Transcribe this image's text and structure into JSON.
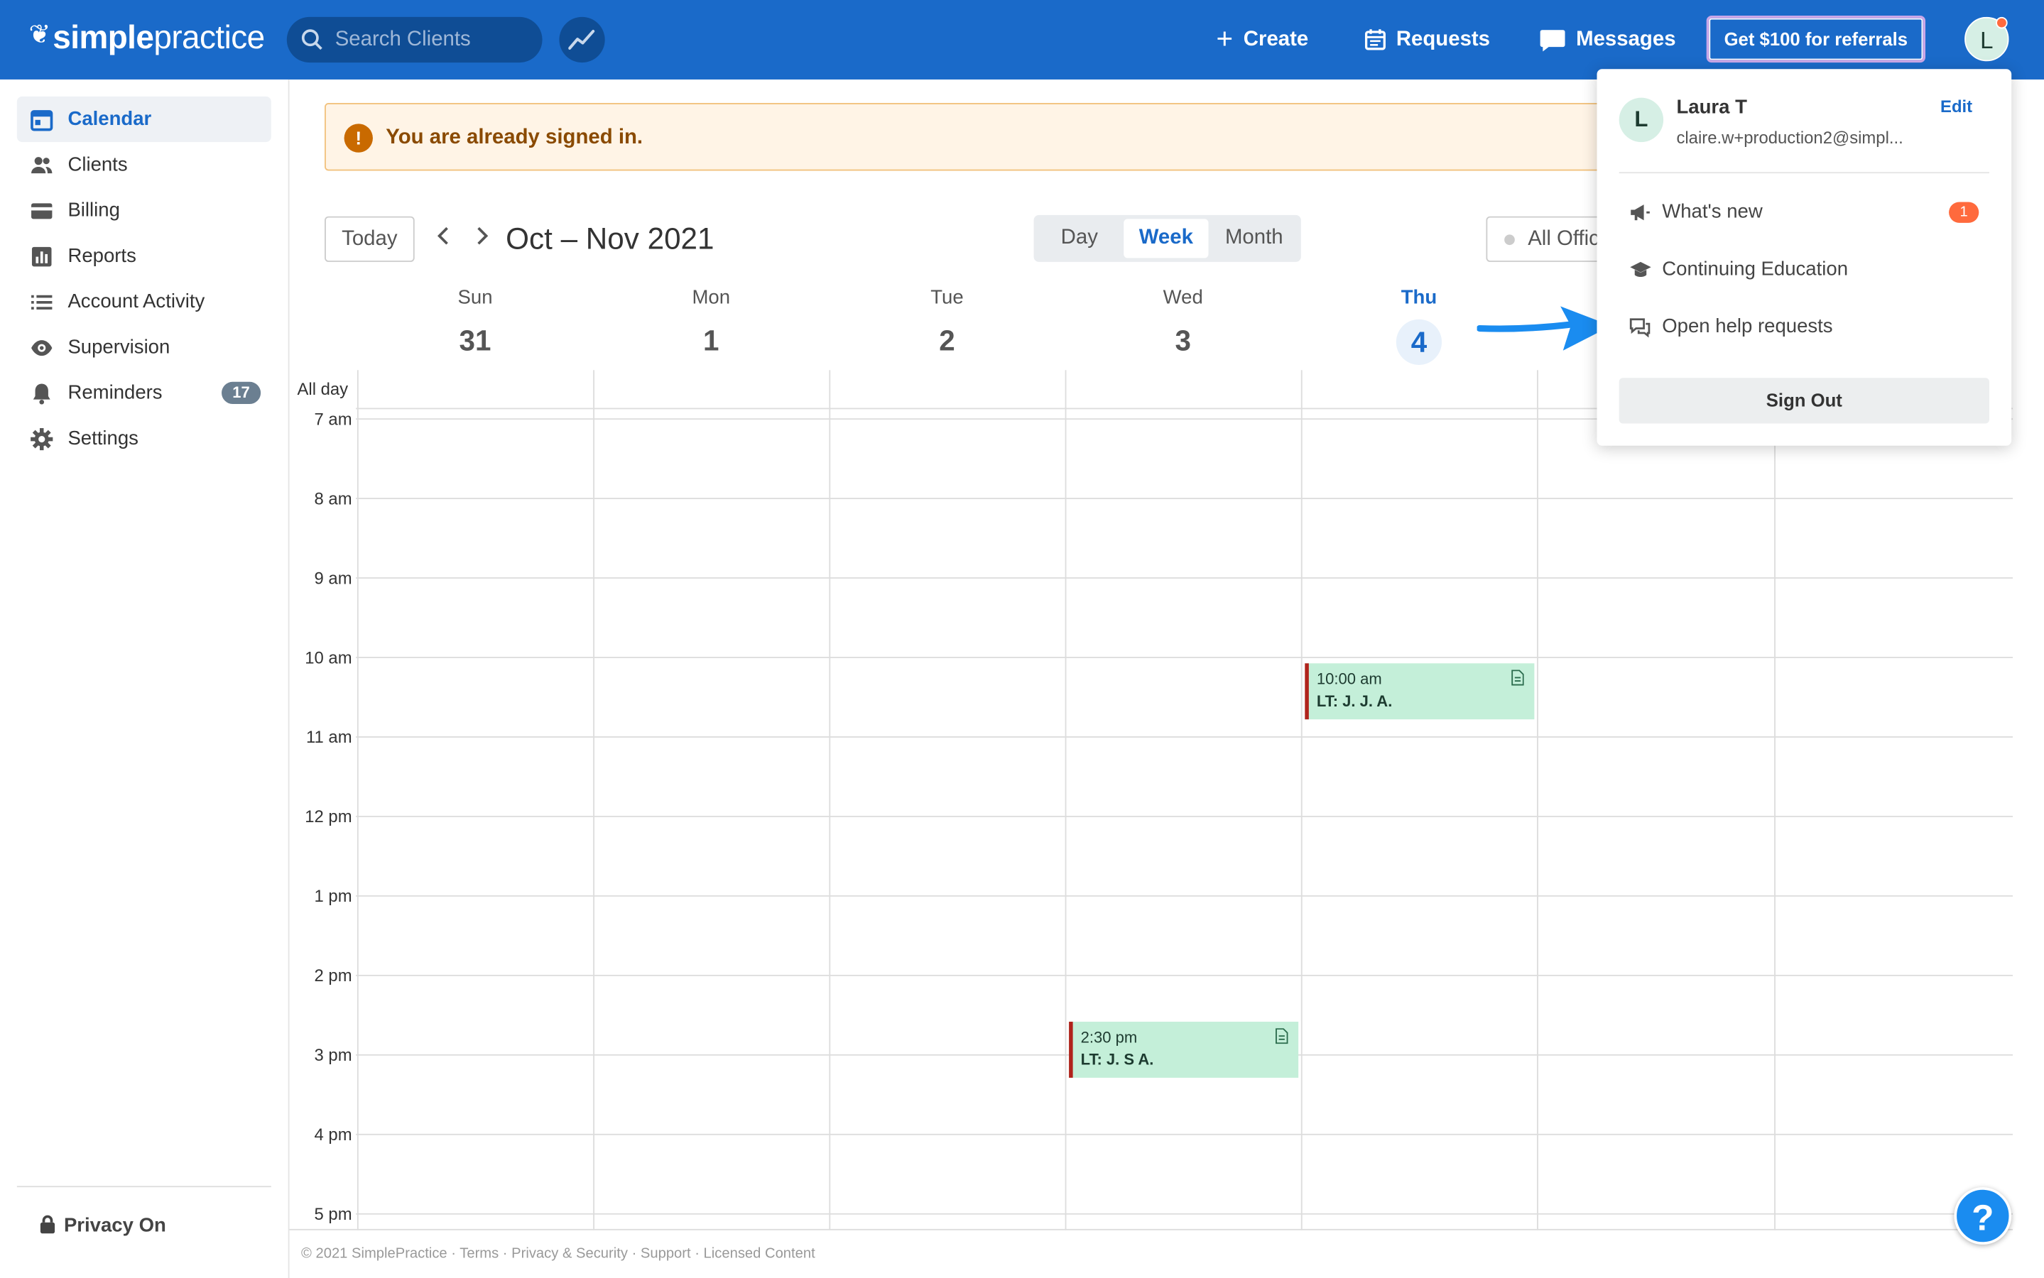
{
  "brand": {
    "logo_bold": "simple",
    "logo_light": "practice"
  },
  "topbar": {
    "search_placeholder": "Search Clients",
    "create_label": "Create",
    "requests_label": "Requests",
    "messages_label": "Messages",
    "referral_label": "Get $100 for referrals",
    "avatar_initial": "L"
  },
  "sidebar": {
    "items": [
      {
        "label": "Calendar",
        "icon": "calendar-icon",
        "active": true
      },
      {
        "label": "Clients",
        "icon": "clients-icon"
      },
      {
        "label": "Billing",
        "icon": "credit-card-icon"
      },
      {
        "label": "Reports",
        "icon": "reports-icon"
      },
      {
        "label": "Account Activity",
        "icon": "list-icon"
      },
      {
        "label": "Supervision",
        "icon": "eye-icon"
      },
      {
        "label": "Reminders",
        "icon": "bell-icon",
        "badge": "17"
      },
      {
        "label": "Settings",
        "icon": "gear-icon"
      }
    ],
    "privacy_label": "Privacy On"
  },
  "alert": {
    "icon": "!",
    "message": "You are already signed in."
  },
  "toolbar": {
    "today_label": "Today",
    "prev_icon": "‹",
    "next_icon": "›",
    "range_title": "Oct – Nov 2021",
    "views": [
      "Day",
      "Week",
      "Month"
    ],
    "active_view": "Week",
    "office_label": "All Offic"
  },
  "calendar": {
    "days": [
      {
        "name": "Sun",
        "date": "31"
      },
      {
        "name": "Mon",
        "date": "1"
      },
      {
        "name": "Tue",
        "date": "2"
      },
      {
        "name": "Wed",
        "date": "3"
      },
      {
        "name": "Thu",
        "date": "4",
        "today": true
      }
    ],
    "allday_label": "All day",
    "hours": [
      "7 am",
      "8 am",
      "9 am",
      "10 am",
      "11 am",
      "12 pm",
      "1 pm",
      "2 pm",
      "3 pm",
      "4 pm",
      "5 pm"
    ],
    "events": [
      {
        "time": "10:00 am",
        "name": "LT: J. J. A.",
        "day": "Thu"
      },
      {
        "time": "2:30 pm",
        "name": "LT: J. S A.",
        "day": "Wed"
      }
    ]
  },
  "dropdown": {
    "initial": "L",
    "name": "Laura T",
    "email": "claire.w+production2@simpl...",
    "edit_label": "Edit",
    "items": [
      {
        "label": "What's new",
        "icon": "megaphone-icon",
        "badge": "1"
      },
      {
        "label": "Continuing Education",
        "icon": "graduation-cap-icon"
      },
      {
        "label": "Open help requests",
        "icon": "chat-bubbles-icon"
      }
    ],
    "signout_label": "Sign Out"
  },
  "footer": {
    "text": "© 2021 SimplePractice · Terms · Privacy & Security · Support · Licensed Content"
  },
  "help_fab": "?",
  "colors": {
    "primary": "#1a6ac9",
    "event_bg": "#c4efd9",
    "event_border": "#b0221b",
    "alert_bg": "#fff4e6",
    "badge_orange": "#ff6a3d"
  }
}
